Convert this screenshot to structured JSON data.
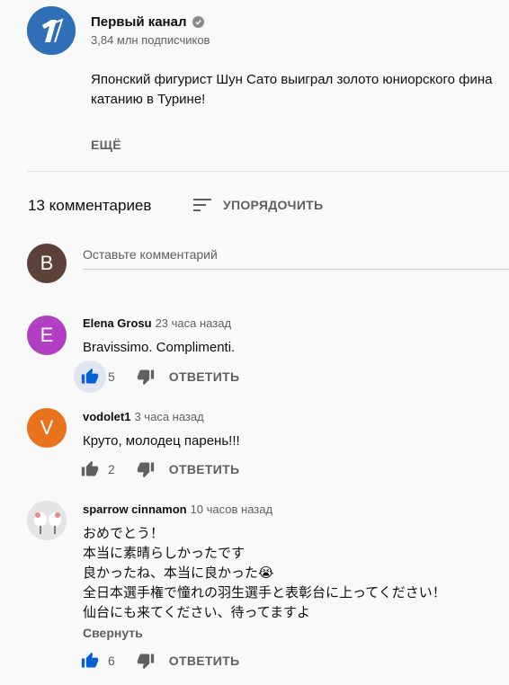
{
  "channel": {
    "name": "Первый канал",
    "subscribers": "3,84 млн подписчиков",
    "description_lines": [
      "Японский фигурист Шун Сато выиграл золото юниорского фина",
      "катанию в Турине!"
    ],
    "more_label": "ЕЩЁ"
  },
  "comments_header": {
    "count_label": "13 комментариев",
    "sort_label": "УПОРЯДОЧИТЬ"
  },
  "new_comment": {
    "avatar_letter": "B",
    "placeholder": "Оставьте комментарий"
  },
  "comments": [
    {
      "author": "Elena Grosu",
      "time": "23 часа назад",
      "avatar_letter": "E",
      "avatar_color": "#b03fc1",
      "text_lines": [
        "Bravissimo. Complimenti."
      ],
      "likes": "5",
      "liked": true,
      "reply_label": "ОТВЕТИТЬ"
    },
    {
      "author": "vodolet1",
      "time": "3 часа назад",
      "avatar_letter": "V",
      "avatar_color": "#e9721c",
      "text_lines": [
        "Круто, молодец парень!!!"
      ],
      "likes": "2",
      "liked": false,
      "reply_label": "ОТВЕТИТЬ"
    },
    {
      "author": "sparrow cinnamon",
      "time": "10 часов назад",
      "avatar_letter": "",
      "avatar_color": "#e6e6e6",
      "text_lines": [
        "おめでとう！",
        "本当に素晴らしかったです",
        "良かったね、本当に良かった😭",
        "全日本選手権で憧れの羽生選手と表彰台に上ってください！",
        "仙台にも来てください、待ってますよ"
      ],
      "collapse_label": "Свернуть",
      "likes": "6",
      "liked": true,
      "reply_label": "ОТВЕТИТЬ"
    }
  ],
  "colors": {
    "like_blue": "#065fd4",
    "icon_gray": "#606060"
  }
}
